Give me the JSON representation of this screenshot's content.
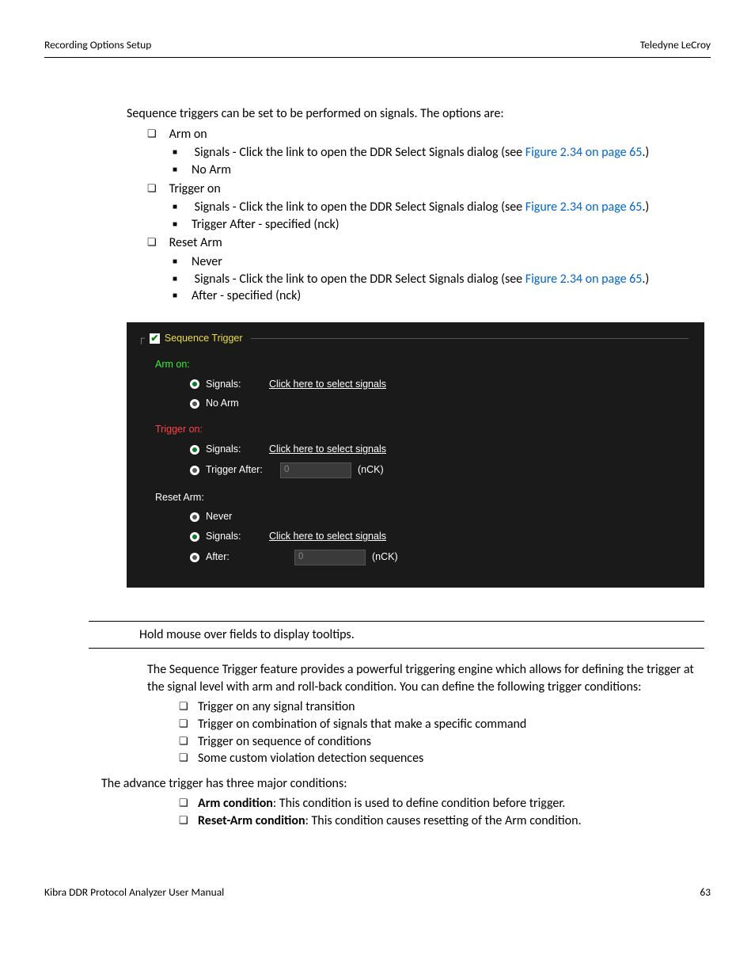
{
  "header": {
    "left": "Recording Options Setup",
    "right": "Teledyne LeCroy"
  },
  "intro": "Sequence triggers can be set to be performed on signals. The options are:",
  "opts": {
    "arm_on": {
      "title": "Arm on",
      "signals_pre": "Signals - Click the link to open the DDR Select Signals dialog (see ",
      "signals_link": "Figure 2.34 on page 65",
      "signals_post": ".)",
      "no_arm": "No Arm"
    },
    "trigger_on": {
      "title": "Trigger on",
      "signals_pre": "Signals - Click the link to open the DDR Select Signals dialog (see ",
      "signals_link": "Figure 2.34 on page 65",
      "signals_post": ".)",
      "trigger_after": "Trigger After - specified (nck)"
    },
    "reset_arm": {
      "title": "Reset Arm",
      "never": "Never",
      "signals_pre": "Signals - Click the link to open the DDR Select Signals dialog (see ",
      "signals_link": "Figure 2.34 on page 65",
      "signals_post": ".)",
      "after": "After - specified (nck)"
    }
  },
  "shot": {
    "group": "Sequence Trigger",
    "arm_on": "Arm on:",
    "trigger_on": "Trigger on:",
    "reset_arm": "Reset Arm:",
    "signals": "Signals:",
    "click": "Click here to select signals",
    "no_arm": "No Arm",
    "trigger_after": "Trigger After:",
    "never": "Never",
    "after": "After:",
    "nck": "(nCK)",
    "val": "0"
  },
  "tip": "Hold mouse over fields to display tooltips.",
  "desc": "The Sequence Trigger feature provides a powerful triggering engine which allows for defining the trigger at the signal level with arm and roll-back condition. You can define the following trigger conditions:",
  "cond": {
    "c1": "Trigger on any signal transition",
    "c2": "Trigger on combination of signals that make a specific command",
    "c3": "Trigger on sequence of conditions",
    "c4": "Some custom violation detection sequences"
  },
  "adv_intro": "The advance trigger has three major conditions:",
  "adv": {
    "arm_label": "Arm condition",
    "arm_text": ": This condition is used to define condition before trigger.",
    "reset_label": "Reset-Arm condition",
    "reset_text": ": This condition causes resetting of the Arm condition."
  },
  "footer": {
    "left": "Kibra DDR Protocol Analyzer User Manual",
    "right": "63"
  }
}
